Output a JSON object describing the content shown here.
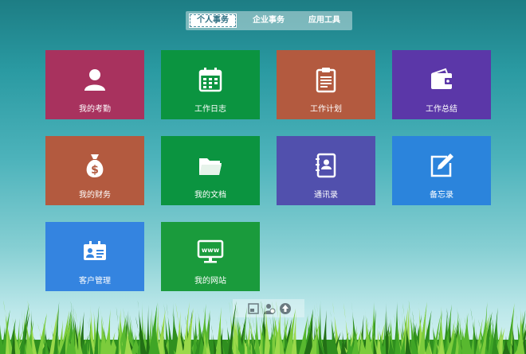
{
  "tabs": [
    {
      "label": "个人事务",
      "active": true
    },
    {
      "label": "企业事务",
      "active": false
    },
    {
      "label": "应用工具",
      "active": false
    }
  ],
  "tiles": [
    {
      "label": "我的考勤",
      "icon": "user-icon",
      "color": "#a8325e"
    },
    {
      "label": "工作日志",
      "icon": "calendar-icon",
      "color": "#0b9440"
    },
    {
      "label": "工作计划",
      "icon": "clipboard-icon",
      "color": "#b35a3f"
    },
    {
      "label": "工作总结",
      "icon": "wallet-icon",
      "color": "#5b37a8"
    },
    {
      "label": "我的财务",
      "icon": "money-bag-icon",
      "color": "#b35a3f"
    },
    {
      "label": "我的文档",
      "icon": "folder-icon",
      "color": "#0b9440"
    },
    {
      "label": "通讯录",
      "icon": "address-book-icon",
      "color": "#5150ad"
    },
    {
      "label": "备忘录",
      "icon": "edit-note-icon",
      "color": "#2b84dc"
    },
    {
      "label": "客户管理",
      "icon": "id-card-icon",
      "color": "#3484e0"
    },
    {
      "label": "我的网站",
      "icon": "www-monitor-icon",
      "color": "#1a9b3c"
    }
  ],
  "bottom_toolbar": [
    {
      "icon": "window-icon"
    },
    {
      "icon": "user-switch-icon"
    },
    {
      "icon": "upload-icon"
    }
  ]
}
